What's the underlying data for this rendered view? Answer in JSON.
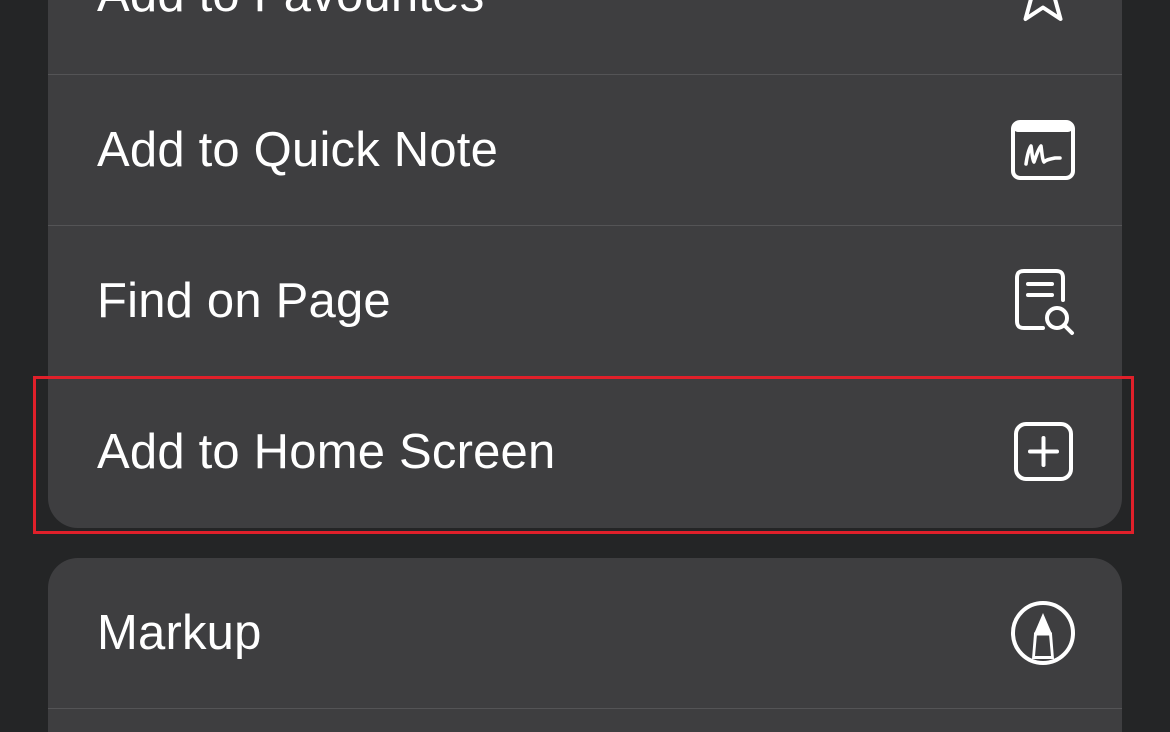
{
  "share_menu": {
    "group_1": [
      {
        "label": "Add to Favourites",
        "icon": "star-icon"
      },
      {
        "label": "Add to Quick Note",
        "icon": "quick-note-icon"
      },
      {
        "label": "Find on Page",
        "icon": "find-on-page-icon"
      },
      {
        "label": "Add to Home Screen",
        "icon": "add-square-icon"
      }
    ],
    "group_2": [
      {
        "label": "Markup",
        "icon": "markup-pen-icon"
      }
    ]
  },
  "colors": {
    "background": "#242526",
    "row_background": "#3e3e40",
    "separator": "#545456",
    "text": "#ffffff",
    "highlight": "#e0202a"
  }
}
